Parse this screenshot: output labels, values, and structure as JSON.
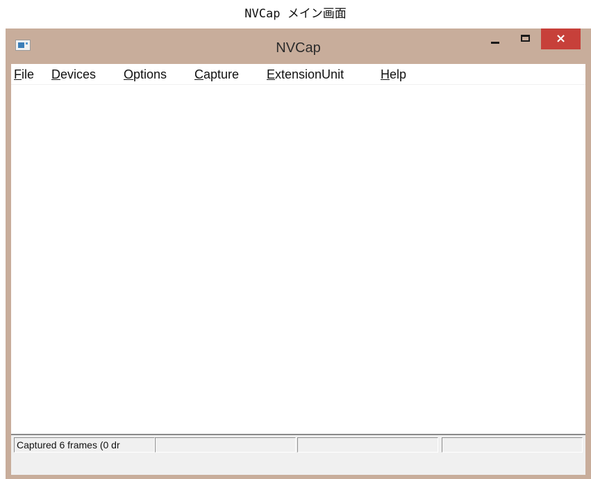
{
  "caption": "NVCap メイン画面",
  "window": {
    "title": "NVCap",
    "close_glyph": "×"
  },
  "menu": [
    {
      "mnemonic": "F",
      "rest": "ile"
    },
    {
      "mnemonic": "D",
      "rest": "evices"
    },
    {
      "mnemonic": "O",
      "rest": "ptions"
    },
    {
      "mnemonic": "C",
      "rest": "apture"
    },
    {
      "mnemonic": "E",
      "rest": "xtensionUnit"
    },
    {
      "mnemonic": "H",
      "rest": "elp"
    }
  ],
  "statusbar": {
    "panes": [
      "Captured 6 frames (0 dr",
      "",
      "",
      ""
    ]
  },
  "colors": {
    "titlebar": "#c8ad9b",
    "close_button": "#c7403a"
  },
  "icons": {
    "app": "app-window-icon",
    "minimize": "minimize-icon",
    "maximize": "maximize-icon",
    "close": "close-icon"
  }
}
